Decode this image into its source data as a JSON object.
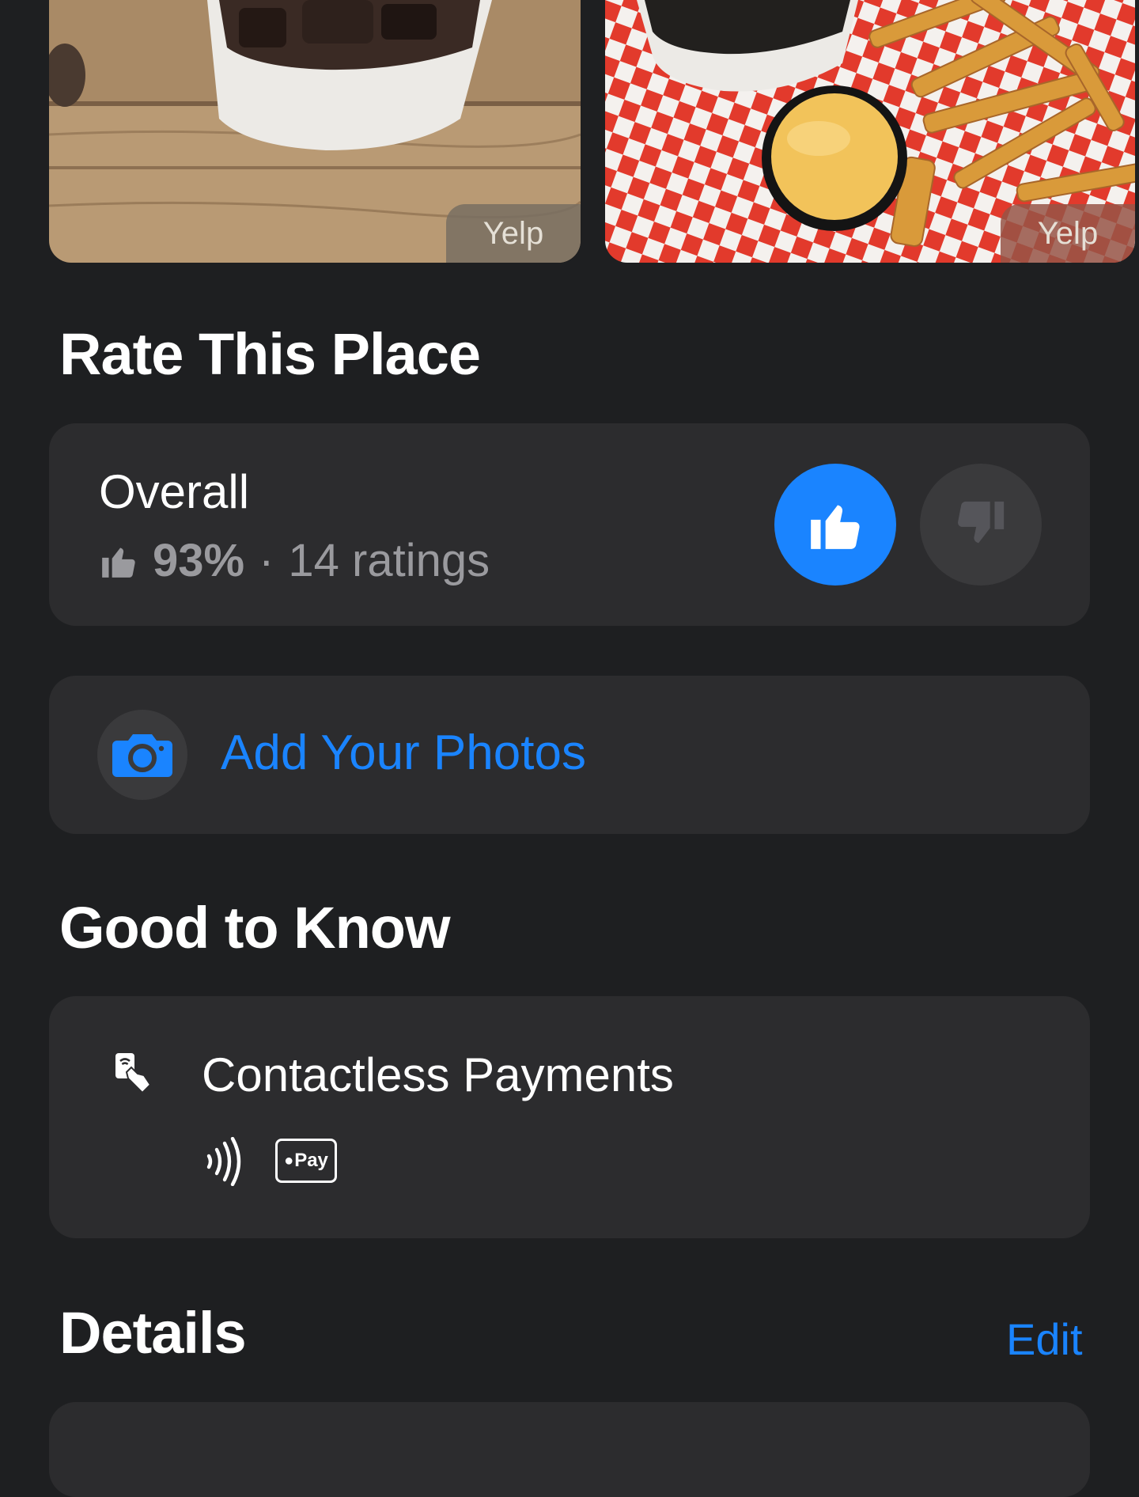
{
  "photos": [
    {
      "source": "Yelp"
    },
    {
      "source": "Yelp"
    }
  ],
  "rate": {
    "title": "Rate This Place",
    "overall_label": "Overall",
    "percent": "93%",
    "separator": "·",
    "ratings": "14 ratings"
  },
  "add_photos": {
    "label": "Add Your Photos"
  },
  "good_to_know": {
    "title": "Good to Know",
    "item_label": "Contactless Payments",
    "apple_pay_label": "Pay"
  },
  "details": {
    "title": "Details",
    "edit_label": "Edit"
  },
  "colors": {
    "background": "#1e1f21",
    "card": "#2c2c2e",
    "accent": "#1a84ff",
    "secondary_text": "#9a9a9e"
  }
}
